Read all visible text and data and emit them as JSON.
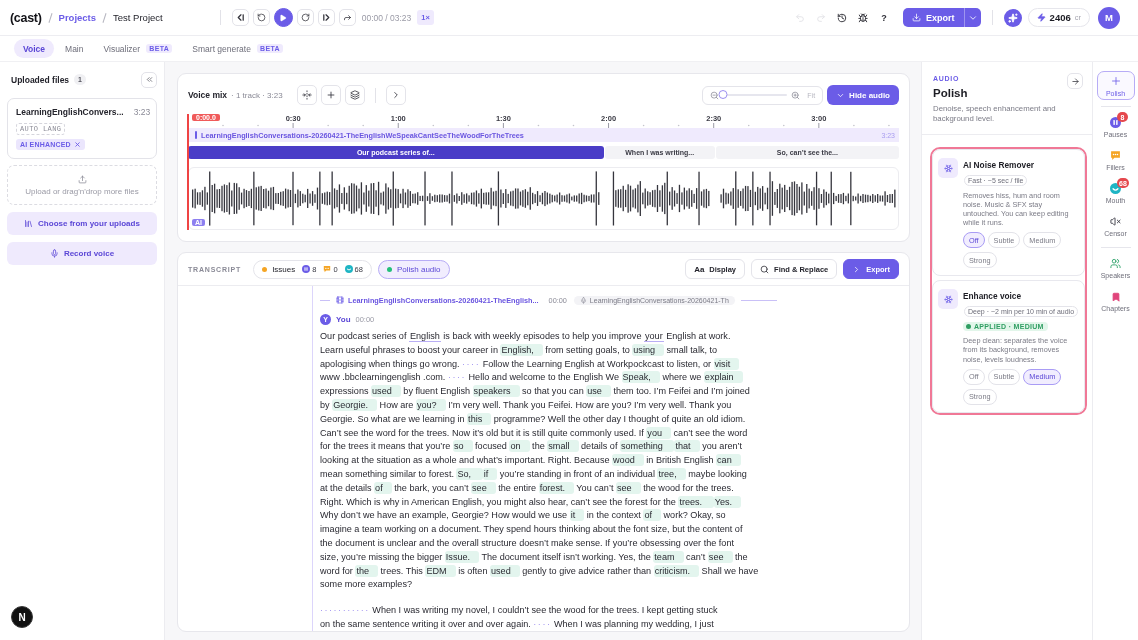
{
  "topbar": {
    "logo": "(cast)",
    "breadcrumbs": [
      {
        "label": "Projects",
        "kind": "link"
      },
      {
        "label": "Test Project",
        "kind": "current"
      }
    ],
    "transport": [
      {
        "kind": "prev"
      },
      {
        "kind": "rewind"
      },
      {
        "kind": "play"
      },
      {
        "kind": "forward"
      },
      {
        "kind": "next"
      },
      {
        "kind": "share"
      }
    ],
    "time": "00:00 / 03:23",
    "speed": "1×",
    "tools": [
      {
        "kind": "undo",
        "disabled": true
      },
      {
        "kind": "redo",
        "disabled": true
      },
      {
        "kind": "history",
        "disabled": false
      },
      {
        "kind": "bug",
        "disabled": false
      },
      {
        "kind": "help",
        "label": "?",
        "disabled": false
      }
    ],
    "export": "Export",
    "credits": {
      "value": "2406",
      "unit": "cr"
    },
    "avatar": "M"
  },
  "tabs": [
    {
      "label": "Voice",
      "selected": true
    },
    {
      "label": "Main",
      "selected": false
    },
    {
      "label": "Visualizer",
      "selected": false,
      "badge": "BETA"
    },
    {
      "label": "Smart generate",
      "selected": false,
      "badge": "BETA"
    }
  ],
  "uploads": {
    "title": "Uploaded files",
    "count": "1",
    "files": [
      {
        "name": "LearningEnglishConvers...",
        "duration": "3:23",
        "tags": [
          {
            "kind": "lang",
            "label": "AUTO LANG",
            "removable": false
          },
          {
            "kind": "enhanced",
            "label": "AI ENHANCED",
            "removable": true
          }
        ]
      }
    ],
    "dropzone": "Upload or drag'n'drop more files",
    "buttons": [
      {
        "kind": "library",
        "label": "Choose from your uploads"
      },
      {
        "kind": "record",
        "label": "Record voice"
      }
    ]
  },
  "dev_badge": "N",
  "voice_mix": {
    "title": "Voice mix",
    "meta": "· 1 track · 3:23",
    "tools": [
      {
        "kind": "split"
      },
      {
        "kind": "add"
      },
      {
        "kind": "layers"
      },
      {
        "kind": "expand"
      }
    ],
    "zoom": {
      "level": 0,
      "fit": "Fit"
    },
    "hide_button": "Hide audio",
    "ruler": [
      "0:30",
      "1:00",
      "1:30",
      "2:00",
      "2:30",
      "3:00"
    ],
    "playhead": "0:00.0",
    "track": {
      "name": "LearningEnglishConversations-20260421-TheEnglishWeSpeakCantSeeTheWoodForTheTrees",
      "duration": "3:23"
    },
    "segments": [
      {
        "label": "Our podcast series of...",
        "selected": true
      },
      {
        "label": "When I was writing...",
        "selected": false
      },
      {
        "label": "So, can’t see the...",
        "selected": false
      }
    ],
    "badge": "AI"
  },
  "transcript": {
    "label": "TRANSCRIPT",
    "issues": {
      "label": "Issues",
      "counts": [
        {
          "kind": "pauses",
          "value": "8"
        },
        {
          "kind": "fillers",
          "value": "0"
        },
        {
          "kind": "mouth",
          "value": "68"
        }
      ]
    },
    "polish": {
      "label": "Polish audio",
      "selected": true
    },
    "actions": [
      {
        "kind": "display",
        "icon_text": "Aa",
        "label": "Display"
      },
      {
        "kind": "find",
        "label": "Find & Replace"
      },
      {
        "kind": "export",
        "label": "Export"
      }
    ],
    "clip": {
      "title": "LearningEnglishConversations-20260421-TheEnglish...",
      "time": "00:00",
      "source": "LearningEnglishConversations-20260421-Th"
    },
    "speaker": {
      "initial": "Y",
      "name": "You",
      "time": "00:00"
    },
    "paragraphs": [
      {
        "lines": [
          [
            {
              "kind": "text",
              "text": "Our podcast series of "
            },
            {
              "kind": "underline",
              "text": "English"
            },
            {
              "kind": "text",
              "text": " is back with weekly episodes to help you improve "
            },
            {
              "kind": "underline",
              "text": "your"
            },
            {
              "kind": "text",
              "text": " English at work."
            }
          ],
          [
            {
              "kind": "text",
              "text": "Learn useful phrases to boost your career in "
            },
            {
              "kind": "mark",
              "text": "English,"
            },
            {
              "kind": "text",
              "text": " from setting goals, to "
            },
            {
              "kind": "mark",
              "text": "using"
            },
            {
              "kind": "text",
              "text": " small talk, to"
            }
          ],
          [
            {
              "kind": "text",
              "text": "apologising when things go wrong. "
            },
            {
              "kind": "pause",
              "text": "····"
            },
            {
              "kind": "text",
              "text": " Follow the Learning English at Workpockcast to listen, or "
            },
            {
              "kind": "mark",
              "text": "visit"
            }
          ],
          [
            {
              "kind": "text",
              "text": "www .bbclearningenglish .com. "
            },
            {
              "kind": "pause",
              "text": "····"
            },
            {
              "kind": "text",
              "text": " Hello and welcome to the English We "
            },
            {
              "kind": "mark",
              "text": "Speak,"
            },
            {
              "kind": "text",
              "text": " where we "
            },
            {
              "kind": "mark",
              "text": "explain"
            }
          ],
          [
            {
              "kind": "text",
              "text": "expressions "
            },
            {
              "kind": "mark",
              "text": "used"
            },
            {
              "kind": "text",
              "text": " by fluent English "
            },
            {
              "kind": "mark",
              "text": "speakers"
            },
            {
              "kind": "text",
              "text": " so that you can "
            },
            {
              "kind": "mark",
              "text": "use"
            },
            {
              "kind": "text",
              "text": " them too. I’m Feifei and I’m joined"
            }
          ],
          [
            {
              "kind": "text",
              "text": "by "
            },
            {
              "kind": "mark",
              "text": "Georgie."
            },
            {
              "kind": "text",
              "text": " How are "
            },
            {
              "kind": "mark",
              "text": "you?"
            },
            {
              "kind": "text",
              "text": " I’m very well. Thank you Feifei. How are you? I’m very well. Thank you"
            }
          ],
          [
            {
              "kind": "text",
              "text": "Georgie. So what are we learning in "
            },
            {
              "kind": "mark",
              "text": "this"
            },
            {
              "kind": "text",
              "text": " programme? Well the other day I thought of quite an old idiom."
            }
          ],
          [
            {
              "kind": "text",
              "text": "Can’t see the word for the trees. Now it’s old but it is still quite commonly used. If "
            },
            {
              "kind": "mark",
              "text": "you"
            },
            {
              "kind": "text",
              "text": " can’t see the word"
            }
          ],
          [
            {
              "kind": "text",
              "text": "for the trees it means that you’re "
            },
            {
              "kind": "mark",
              "text": "so"
            },
            {
              "kind": "text",
              "text": " focused "
            },
            {
              "kind": "mark",
              "text": "on"
            },
            {
              "kind": "text",
              "text": " the "
            },
            {
              "kind": "mark",
              "text": "small"
            },
            {
              "kind": "text",
              "text": " details of "
            },
            {
              "kind": "mark",
              "text": "something "
            },
            {
              "kind": "mark",
              "text": "that"
            },
            {
              "kind": "text",
              "text": " you aren’t"
            }
          ],
          [
            {
              "kind": "text",
              "text": "looking at the situation as a whole and what’s important. Right. Because "
            },
            {
              "kind": "mark",
              "text": "wood"
            },
            {
              "kind": "text",
              "text": " in British English "
            },
            {
              "kind": "mark",
              "text": "can"
            }
          ],
          [
            {
              "kind": "text",
              "text": "mean something similar to forest. "
            },
            {
              "kind": "mark",
              "text": "So, "
            },
            {
              "kind": "mark",
              "text": "if"
            },
            {
              "kind": "text",
              "text": " you’re standing in front of an individual "
            },
            {
              "kind": "mark",
              "text": "tree,"
            },
            {
              "kind": "text",
              "text": " maybe looking"
            }
          ],
          [
            {
              "kind": "text",
              "text": "at the details "
            },
            {
              "kind": "mark",
              "text": "of"
            },
            {
              "kind": "text",
              "text": " the bark, you can’t "
            },
            {
              "kind": "mark",
              "text": "see"
            },
            {
              "kind": "text",
              "text": " the entire "
            },
            {
              "kind": "mark",
              "text": "forest."
            },
            {
              "kind": "text",
              "text": " You can’t "
            },
            {
              "kind": "mark",
              "text": "see"
            },
            {
              "kind": "text",
              "text": " the wood for the trees."
            }
          ],
          [
            {
              "kind": "text",
              "text": "Right. Which is why in American English, you might also hear, can’t see the forest for the "
            },
            {
              "kind": "mark",
              "text": "trees. "
            },
            {
              "kind": "mark",
              "text": "Yes."
            }
          ],
          [
            {
              "kind": "text",
              "text": "Why don’t we have an example, Georgie? How would we use "
            },
            {
              "kind": "mark",
              "text": "it"
            },
            {
              "kind": "text",
              "text": " in the context "
            },
            {
              "kind": "mark",
              "text": "of"
            },
            {
              "kind": "text",
              "text": " work? Okay, so"
            }
          ],
          [
            {
              "kind": "text",
              "text": "imagine a team working on a document. They spend hours thinking about the font size, but the content of"
            }
          ],
          [
            {
              "kind": "text",
              "text": "the document is unclear and the overall structure doesn’t make sense. If you’re obsessing over the font"
            }
          ],
          [
            {
              "kind": "text",
              "text": "size, you’re missing the bigger "
            },
            {
              "kind": "mark",
              "text": "Issue."
            },
            {
              "kind": "text",
              "text": " The document itself isn’t working. Yes, the "
            },
            {
              "kind": "mark",
              "text": "team"
            },
            {
              "kind": "text",
              "text": " can’t "
            },
            {
              "kind": "mark",
              "text": "see"
            },
            {
              "kind": "text",
              "text": " the"
            }
          ],
          [
            {
              "kind": "text",
              "text": "word for "
            },
            {
              "kind": "mark",
              "text": "the"
            },
            {
              "kind": "text",
              "text": " trees. This "
            },
            {
              "kind": "mark",
              "text": "EDM"
            },
            {
              "kind": "text",
              "text": " is often "
            },
            {
              "kind": "mark",
              "text": "used"
            },
            {
              "kind": "text",
              "text": " gently to give advice rather than "
            },
            {
              "kind": "mark",
              "text": "criticism."
            },
            {
              "kind": "text",
              "text": " Shall we have"
            }
          ],
          [
            {
              "kind": "text",
              "text": "some more examples?"
            }
          ]
        ]
      },
      {
        "lines": [
          [
            {
              "kind": "pause",
              "text": "···········"
            },
            {
              "kind": "text",
              "text": " When I was writing my novel, I couldn’t see the wood for the trees. I kept getting stuck"
            }
          ],
          [
            {
              "kind": "text",
              "text": "on the same sentence writing it over and over again. "
            },
            {
              "kind": "pause",
              "text": "····"
            },
            {
              "kind": "text",
              "text": " When I was planning my wedding, I just"
            }
          ]
        ]
      }
    ]
  },
  "polish_panel": {
    "section": "AUDIO",
    "title": "Polish",
    "description": "Denoise, speech enhancement and background level.",
    "highlighted": true,
    "tools": [
      {
        "title": "AI Noise Remover",
        "speed": "Fast · ~5 sec / file",
        "description": "Removes hiss, hum and room noise. Music & SFX stay untouched. You can keep editing while it runs.",
        "options": [
          {
            "label": "Off",
            "selected": true
          },
          {
            "label": "Subtle",
            "selected": false
          },
          {
            "label": "Medium",
            "selected": false
          },
          {
            "label": "Strong",
            "selected": false
          }
        ]
      },
      {
        "title": "Enhance voice",
        "speed": "Deep · ~2 min per 10 min of audio",
        "status": "APPLIED · MEDIUM",
        "description": "Deep clean: separates the voice from its background, removes noise, levels loudness.",
        "options": [
          {
            "label": "Off",
            "selected": false
          },
          {
            "label": "Subtle",
            "selected": false
          },
          {
            "label": "Medium",
            "selected": true
          },
          {
            "label": "Strong",
            "selected": false
          }
        ]
      }
    ]
  },
  "rail": [
    {
      "kind": "polish",
      "label": "Polish",
      "divider_before": false,
      "selected": true
    },
    {
      "kind": "pauses",
      "label": "Pauses",
      "badge": "8",
      "divider_before": true,
      "selected": false
    },
    {
      "kind": "fillers",
      "label": "Fillers",
      "divider_before": false,
      "selected": false
    },
    {
      "kind": "mouth",
      "label": "Mouth",
      "badge": "68",
      "divider_before": false,
      "selected": false
    },
    {
      "kind": "censor",
      "label": "Censor",
      "divider_before": false,
      "selected": false
    },
    {
      "kind": "speakers",
      "label": "Speakers",
      "divider_before": true,
      "selected": false
    },
    {
      "kind": "chapters",
      "label": "Chapters",
      "divider_before": false,
      "selected": false
    }
  ]
}
